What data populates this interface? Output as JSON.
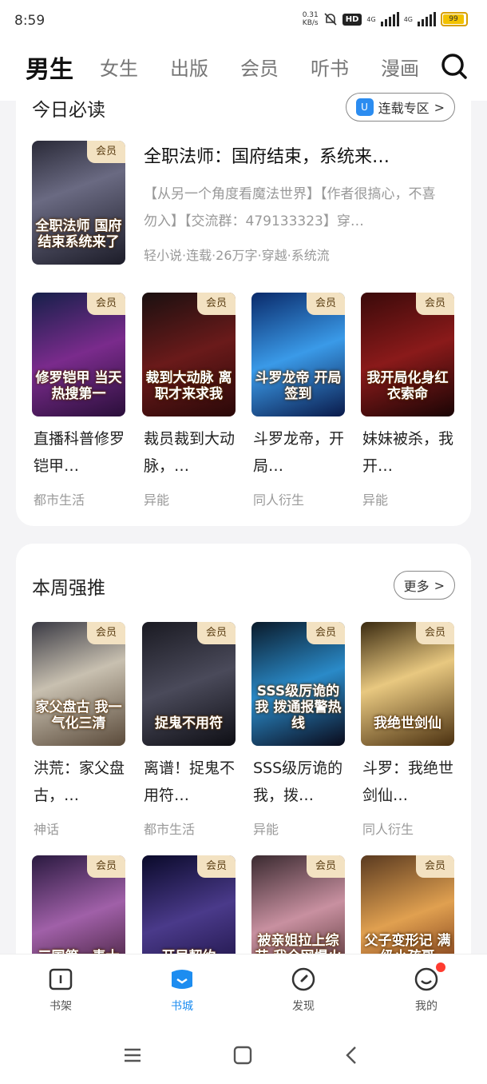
{
  "status": {
    "time": "8:59",
    "net_speed": "0.31",
    "net_unit": "KB/s",
    "hd": "HD",
    "sig1": "4G",
    "sig2": "4G",
    "battery": "99"
  },
  "tabs": [
    "男生",
    "女生",
    "出版",
    "会员",
    "听书",
    "漫画"
  ],
  "accent_color": "#1d8df0",
  "today": {
    "title": "今日必读",
    "button": "连载专区",
    "featured": {
      "cover_text": "全职法师 国府结束系统来了",
      "badge": "会员",
      "title": "全职法师：国府结束，系统来…",
      "desc": "【从另一个角度看魔法世界】【作者很搞心，不喜勿入】【交流群：479133323】穿…",
      "meta": "轻小说·连载·26万字·穿越·系统流"
    },
    "books": [
      {
        "cover_text": "修罗铠甲 当天热搜第一",
        "badge": "会员",
        "title": "直播科普修罗铠甲…",
        "tag": "都市生活"
      },
      {
        "cover_text": "裁到大动脉 离职才来求我",
        "badge": "会员",
        "title": "裁员裁到大动脉，…",
        "tag": "异能"
      },
      {
        "cover_text": "斗罗龙帝 开局签到",
        "badge": "会员",
        "title": "斗罗龙帝，开局…",
        "tag": "同人衍生"
      },
      {
        "cover_text": "我开局化身红衣索命",
        "badge": "会员",
        "title": "妹妹被杀，我开…",
        "tag": "异能"
      }
    ]
  },
  "weekly": {
    "title": "本周强推",
    "button": "更多",
    "books": [
      {
        "cover_text": "家父盘古 我一气化三清",
        "badge": "会员",
        "title": "洪荒：家父盘古，…",
        "tag": "神话"
      },
      {
        "cover_text": "捉鬼不用符",
        "badge": "会员",
        "title": "离谱！捉鬼不用符…",
        "tag": "都市生活"
      },
      {
        "cover_text": "SSS级厉诡的我 拨通报警热线",
        "badge": "会员",
        "title": "SSS级厉诡的我，拨…",
        "tag": "异能"
      },
      {
        "cover_text": "我绝世剑仙",
        "badge": "会员",
        "title": "斗罗：我绝世剑仙…",
        "tag": "同人衍生"
      },
      {
        "cover_text": "三国第一毒士",
        "badge": "会员"
      },
      {
        "cover_text": "开局契约",
        "badge": "会员"
      },
      {
        "cover_text": "被亲姐拉上综艺 我全网爆火",
        "badge": "会员"
      },
      {
        "cover_text": "父子变形记 满级小孩哥",
        "badge": "会员"
      }
    ]
  },
  "bottom_nav": [
    "书架",
    "书城",
    "发现",
    "我的"
  ]
}
